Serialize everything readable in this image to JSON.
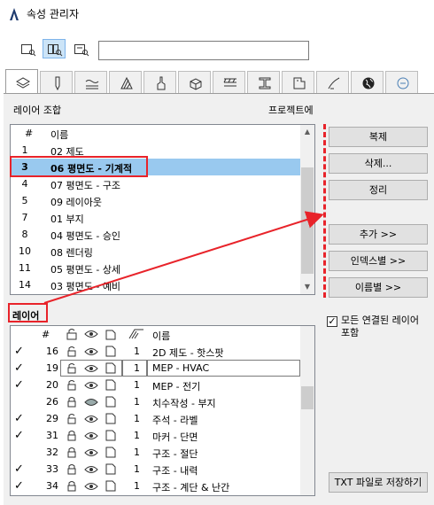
{
  "window": {
    "title": "속성 관리자"
  },
  "combinations": {
    "section_label": "레이어 조합",
    "project_label": "프로젝트에",
    "header": {
      "num": "#",
      "name": "이름"
    },
    "rows": [
      {
        "num": "1",
        "name": "02 제도"
      },
      {
        "num": "3",
        "name": "06 평면도 - 기계적",
        "selected": true
      },
      {
        "num": "4",
        "name": "07 평면도 - 구조"
      },
      {
        "num": "5",
        "name": "09 레이아웃"
      },
      {
        "num": "7",
        "name": "01 부지"
      },
      {
        "num": "8",
        "name": "04 평면도 - 승인"
      },
      {
        "num": "10",
        "name": "08 렌더링"
      },
      {
        "num": "11",
        "name": "05 평면도 - 상세"
      },
      {
        "num": "14",
        "name": "03 평면도 - 예비"
      }
    ]
  },
  "buttons": {
    "duplicate": "복제",
    "delete": "삭제...",
    "clean": "정리",
    "add": "추가 >>",
    "by_index": "인덱스별 >>",
    "by_name": "이름별 >>",
    "save_txt": "TXT 파일로 저장하기"
  },
  "layers": {
    "section_label": "레이어",
    "header": {
      "num": "#",
      "pen": "",
      "name": "이름"
    },
    "rows": [
      {
        "checked": true,
        "num": "16",
        "pen": "1",
        "name": "2D 제도 - 핫스팟",
        "lock": "open",
        "visible": true
      },
      {
        "checked": true,
        "num": "19",
        "pen": "1",
        "name": "MEP - HVAC",
        "lock": "open",
        "visible": true,
        "editing": true
      },
      {
        "checked": true,
        "num": "20",
        "pen": "1",
        "name": "MEP - 전기",
        "lock": "open",
        "visible": true
      },
      {
        "checked": false,
        "num": "26",
        "pen": "1",
        "name": "치수작성 - 부지",
        "lock": "closed",
        "visible": false
      },
      {
        "checked": true,
        "num": "29",
        "pen": "1",
        "name": "주석 - 라벨",
        "lock": "open",
        "visible": true
      },
      {
        "checked": true,
        "num": "31",
        "pen": "1",
        "name": "마커 - 단면",
        "lock": "closed",
        "visible": true
      },
      {
        "checked": false,
        "num": "32",
        "pen": "1",
        "name": "구조 - 절단",
        "lock": "closed",
        "visible": true
      },
      {
        "checked": true,
        "num": "33",
        "pen": "1",
        "name": "구조 - 내력",
        "lock": "closed",
        "visible": true
      },
      {
        "checked": true,
        "num": "34",
        "pen": "1",
        "name": "구조 - 계단 & 난간",
        "lock": "closed",
        "visible": true
      }
    ]
  },
  "include_connected": {
    "label": "모든 연결된 레이어 포함",
    "checked": true
  },
  "search": {
    "value": "",
    "placeholder": ""
  },
  "colors": {
    "annotation": "#e8232a",
    "selection": "#99c9ef"
  },
  "tabs": [
    {
      "icon": "layers-icon",
      "active": true
    },
    {
      "icon": "pen-icon"
    },
    {
      "icon": "line-type-icon"
    },
    {
      "icon": "fill-icon"
    },
    {
      "icon": "brush-icon"
    },
    {
      "icon": "building-material-icon"
    },
    {
      "icon": "composite-icon"
    },
    {
      "icon": "profile-icon"
    },
    {
      "icon": "zone-category-icon"
    },
    {
      "icon": "surface-icon"
    },
    {
      "icon": "globe-icon"
    },
    {
      "icon": "more-icon"
    }
  ]
}
